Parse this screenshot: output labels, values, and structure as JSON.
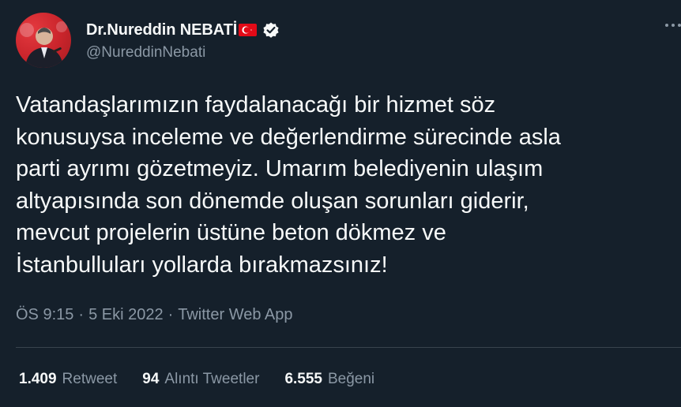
{
  "author": {
    "display_name": "Dr.Nureddin NEBATİ",
    "flag_icon": "turkey-flag-icon",
    "verified_icon": "verified-badge-icon",
    "handle": "@NureddinNebati",
    "avatar_icon": "profile-avatar"
  },
  "tweet": {
    "text": "Vatandaşlarımızın faydalanacağı bir hizmet söz\nkonusuysa inceleme ve değerlendirme sürecinde asla\nparti ayrımı gözetmeyiz. Umarım belediyenin ulaşım\naltyapısında son dönemde oluşan sorunları giderir,\nmevcut projelerin üstüne beton dökmez ve\nİstanbulluları yollarda bırakmazsınız!",
    "time": "ÖS 9:15",
    "separator": "·",
    "date": "5 Eki 2022",
    "source": "Twitter Web App"
  },
  "stats": {
    "retweets_count": "1.409",
    "retweets_label": "Retweet",
    "quotes_count": "94",
    "quotes_label": "Alıntı Tweetler",
    "likes_count": "6.555",
    "likes_label": "Beğeni"
  },
  "colors": {
    "background": "#15202b",
    "text": "#f7f9f9",
    "secondary": "#8b98a5",
    "divider": "#38444d",
    "flag_red": "#e30a17"
  }
}
